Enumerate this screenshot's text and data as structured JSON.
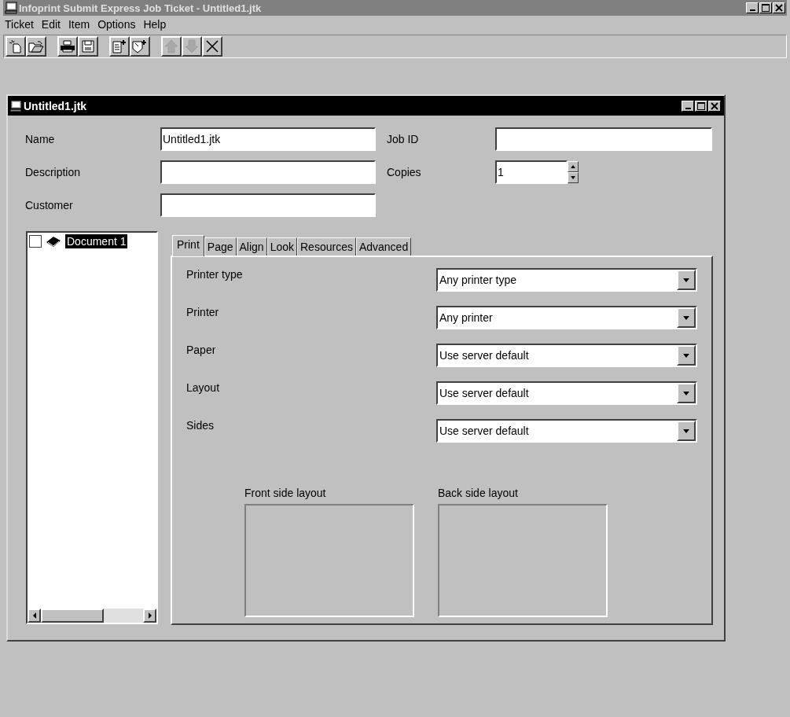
{
  "window": {
    "title": "Infoprint Submit Express Job Ticket - Untitled1.jtk"
  },
  "menu": [
    "Ticket",
    "Edit",
    "Item",
    "Options",
    "Help"
  ],
  "toolbar": [
    [
      {
        "kind": "new",
        "disabled": false
      },
      {
        "kind": "open",
        "disabled": false
      }
    ],
    [
      {
        "kind": "print",
        "disabled": false
      },
      {
        "kind": "save",
        "disabled": false
      }
    ],
    [
      {
        "kind": "add-page",
        "disabled": false
      },
      {
        "kind": "add-document",
        "disabled": false
      }
    ],
    [
      {
        "kind": "up",
        "disabled": true
      },
      {
        "kind": "down",
        "disabled": true
      },
      {
        "kind": "delete",
        "disabled": false
      }
    ]
  ],
  "document_window": {
    "title": "Untitled1.jtk"
  },
  "fields": {
    "name": {
      "label": "Name",
      "value": "Untitled1.jtk"
    },
    "description": {
      "label": "Description"
    },
    "customer": {
      "label": "Customer"
    },
    "job_id": {
      "label": "Job ID"
    },
    "copies": {
      "label": "Copies",
      "value": "1"
    }
  },
  "tree": [
    {
      "label": "Document 1",
      "checked": false,
      "selected": true
    }
  ],
  "tabs": [
    {
      "label": "Print",
      "selected": true
    },
    {
      "label": "Page",
      "selected": false
    },
    {
      "label": "Align",
      "selected": false
    },
    {
      "label": "Look",
      "selected": false
    },
    {
      "label": "Resources",
      "selected": false
    },
    {
      "label": "Advanced",
      "selected": false
    }
  ],
  "print_settings": [
    {
      "label": "Printer type",
      "value": "Any printer type"
    },
    {
      "label": "Printer",
      "value": "Any printer"
    },
    {
      "label": "Paper",
      "value": "Use server default"
    },
    {
      "label": "Layout",
      "value": "Use server default"
    },
    {
      "label": "Sides",
      "value": "Use server default"
    }
  ],
  "layout_previews": [
    {
      "label": "Front side layout"
    },
    {
      "label": "Back side layout"
    }
  ]
}
